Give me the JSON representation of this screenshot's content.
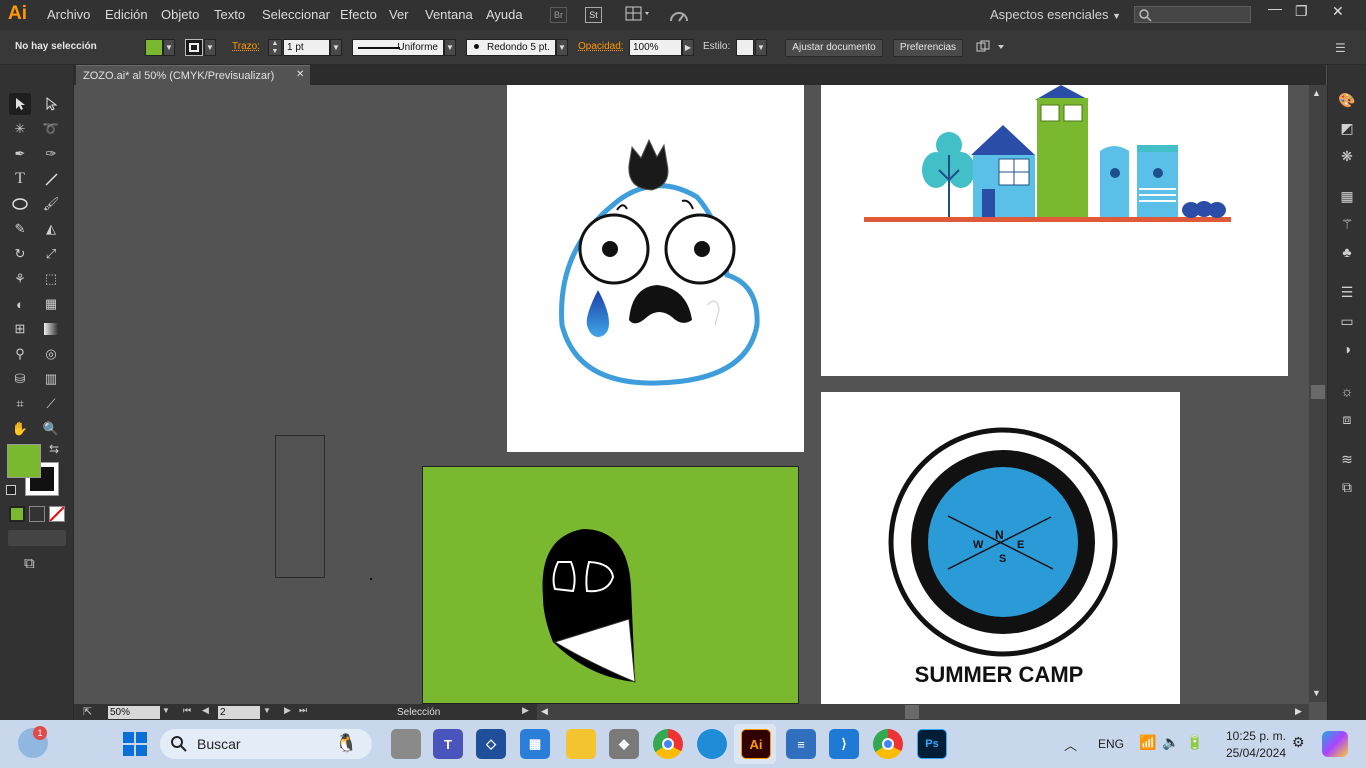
{
  "app": {
    "logo": "Ai",
    "menus": [
      "Archivo",
      "Edición",
      "Objeto",
      "Texto",
      "Seleccionar",
      "Efecto",
      "Ver",
      "Ventana",
      "Ayuda"
    ],
    "bridge": "Br",
    "stock": "St",
    "workspace": "Aspectos esenciales"
  },
  "control": {
    "selection_status": "No hay selección",
    "stroke_label": "Trazo:",
    "stroke_weight": "1 pt",
    "stroke_profile": "Uniforme",
    "brush": "Redondo 5 pt.",
    "opacity_label": "Opacidad:",
    "opacity_value": "100%",
    "style_label": "Estilo:",
    "fit_button": "Ajustar documento",
    "prefs_button": "Preferencias"
  },
  "document": {
    "tab_title": "ZOZO.ai* al 50% (CMYK/Previsualizar)",
    "close": "✕"
  },
  "status": {
    "zoom": "50%",
    "artboard_number": "2",
    "tool_name": "Selección"
  },
  "artwork": {
    "camp_title": "SUMMER CAMP",
    "compass": [
      "N",
      "E",
      "S",
      "W"
    ]
  },
  "colors": {
    "fill": "#7ab82f",
    "accent": "#ff9a00",
    "canvas": "#535353"
  },
  "taskbar": {
    "search_placeholder": "Buscar",
    "notification_count": "1",
    "language": "ENG",
    "time": "10:25 p. m.",
    "date": "25/04/2024"
  }
}
